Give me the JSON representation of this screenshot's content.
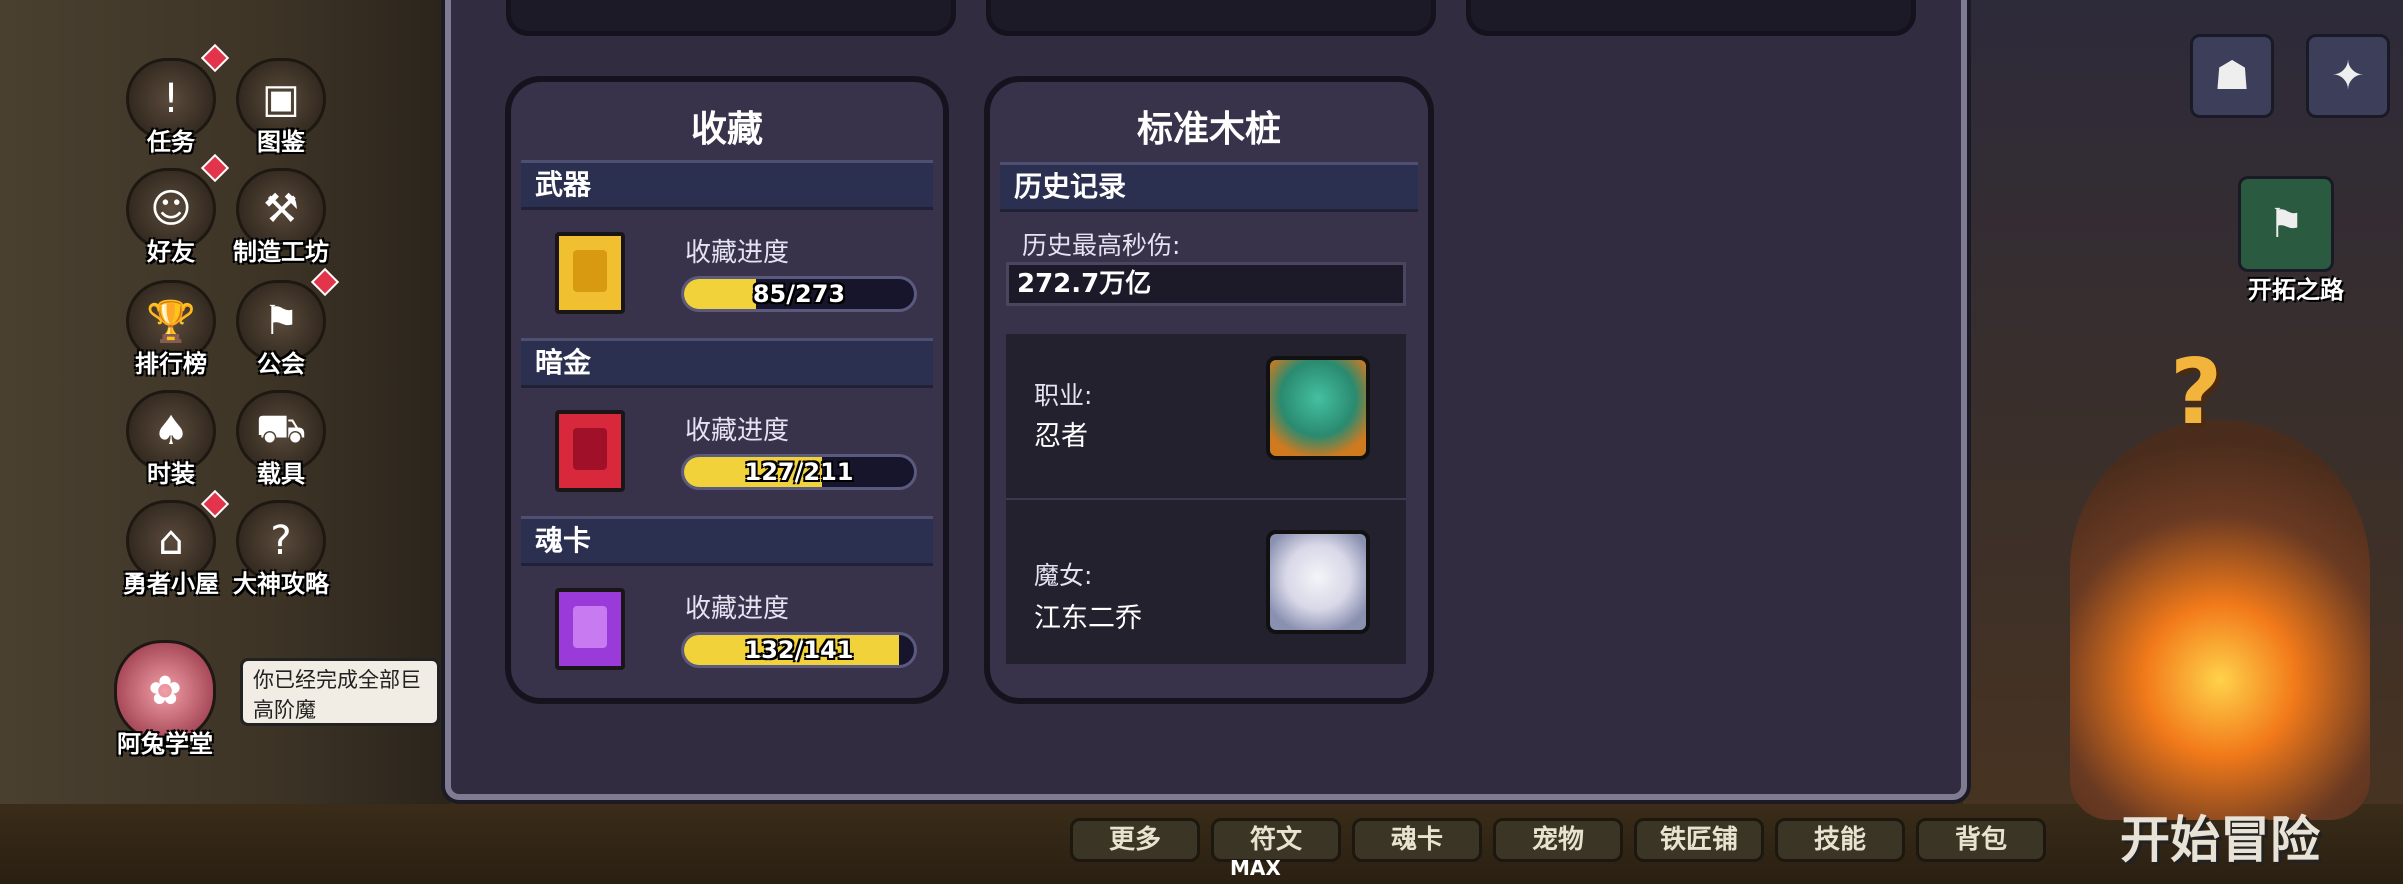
{
  "left_menu": [
    {
      "label": "任务",
      "icon": "quest-icon",
      "glyph": "!"
    },
    {
      "label": "图鉴",
      "icon": "codex-icon",
      "glyph": "▣"
    },
    {
      "label": "好友",
      "icon": "friends-icon",
      "glyph": "☺"
    },
    {
      "label": "制造工坊",
      "icon": "workshop-icon",
      "glyph": "⚒"
    },
    {
      "label": "排行榜",
      "icon": "trophy-icon",
      "glyph": "🏆"
    },
    {
      "label": "公会",
      "icon": "guild-icon",
      "glyph": "⚑"
    },
    {
      "label": "时装",
      "icon": "fashion-icon",
      "glyph": "♠"
    },
    {
      "label": "载具",
      "icon": "vehicle-icon",
      "glyph": "⛟"
    },
    {
      "label": "勇者小屋",
      "icon": "hut-icon",
      "glyph": "⌂"
    },
    {
      "label": "大神攻略",
      "icon": "guide-icon",
      "glyph": "?"
    }
  ],
  "mascot_label": "阿兔学堂",
  "tip_text": "你已经完成全部巨高阶魔",
  "collection": {
    "title": "收藏",
    "progress_label": "收藏进度",
    "sections": [
      {
        "name": "武器",
        "progress_text": "85/273",
        "current": 85,
        "total": 273,
        "color": "#f0c030"
      },
      {
        "name": "暗金",
        "progress_text": "127/211",
        "current": 127,
        "total": 211,
        "color": "#d8283c"
      },
      {
        "name": "魂卡",
        "progress_text": "132/141",
        "current": 132,
        "total": 141,
        "color": "#9a3ad8"
      }
    ]
  },
  "dummy": {
    "title": "标准木桩",
    "section": "历史记录",
    "max_dps_label": "历史最高秒伤:",
    "max_dps_value": "272.7万亿",
    "profession_label": "职业:",
    "profession_value": "忍者",
    "witch_label": "魔女:",
    "witch_value": "江东二乔"
  },
  "bottom_tabs": [
    "更多",
    "符文",
    "魂卡",
    "宠物",
    "铁匠铺",
    "技能",
    "背包"
  ],
  "max_label": "MAX",
  "right_panel": {
    "explore_label": "开拓之路",
    "start_label": "开始冒险"
  }
}
